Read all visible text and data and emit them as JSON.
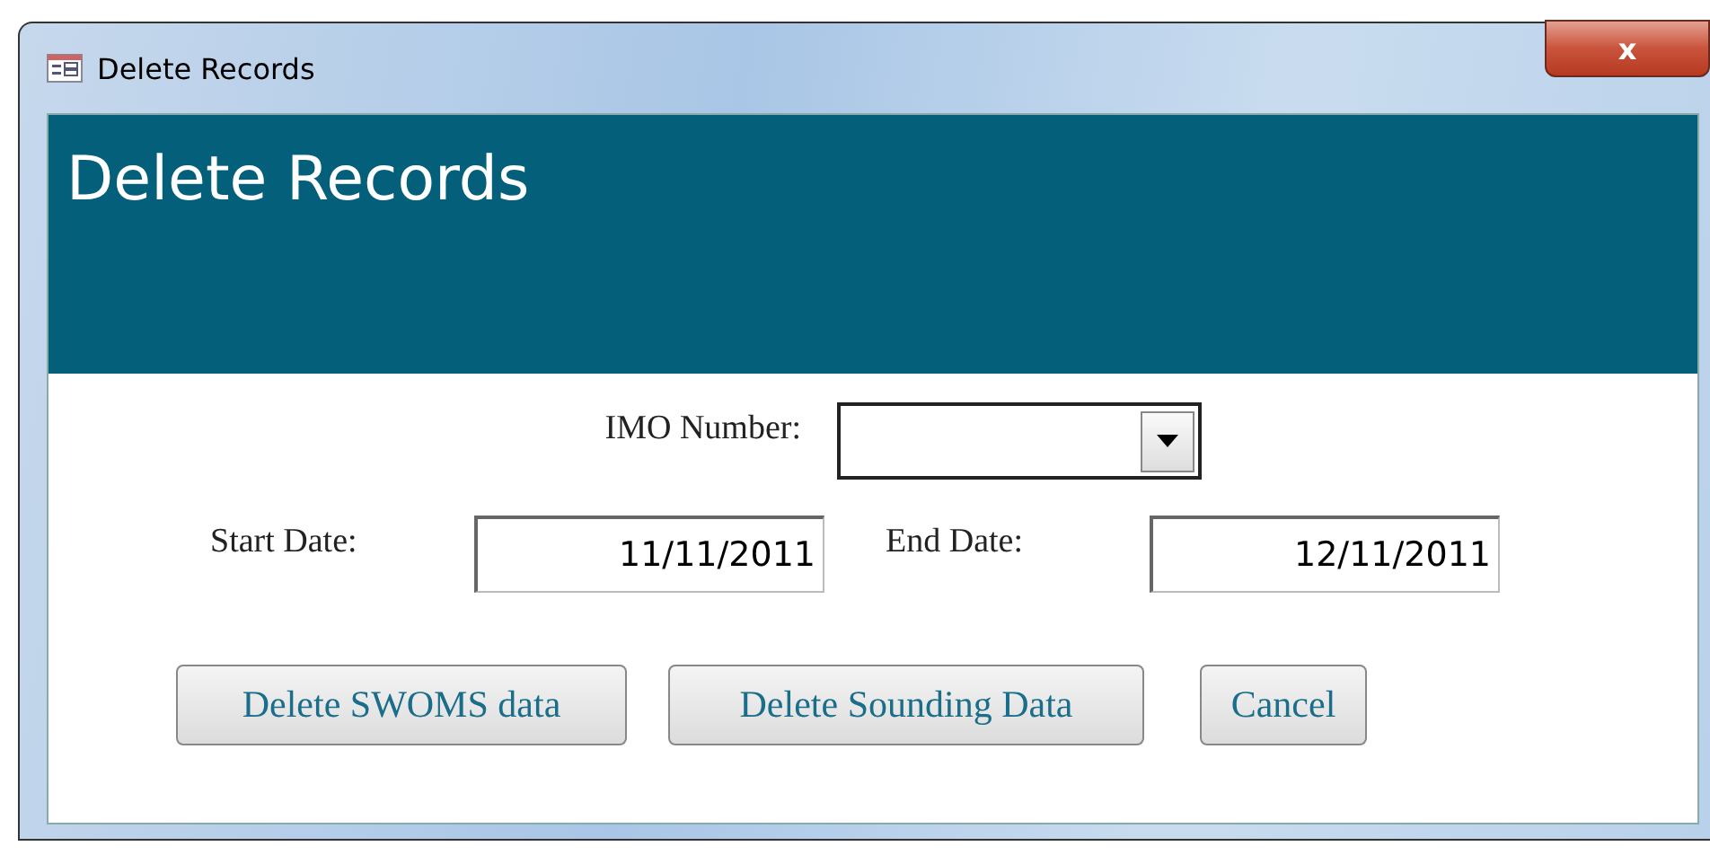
{
  "window": {
    "title": "Delete Records",
    "close": "x"
  },
  "header": {
    "title": "Delete Records"
  },
  "fields": [
    {
      "kind": "combo",
      "label": "IMO Number:"
    },
    {
      "kind": "text",
      "label": "Start Date:",
      "value": "11/11/2011"
    },
    {
      "kind": "text",
      "label": "End Date:",
      "value": "12/11/2011"
    }
  ],
  "buttons": [
    "Delete SWOMS data",
    "Delete Sounding Data",
    "Cancel"
  ]
}
